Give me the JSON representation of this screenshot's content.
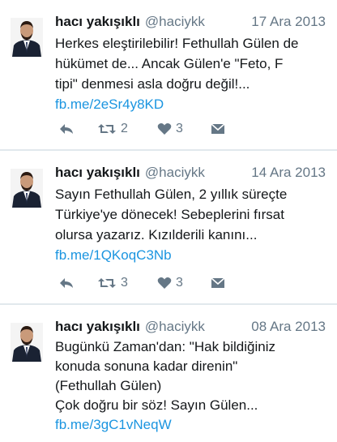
{
  "tweets": [
    {
      "display_name": "hacı yakışıklı",
      "handle": "@haciykk",
      "date": "17 Ara 2013",
      "lines": [
        "Herkes eleştirilebilir! Fethullah Gülen de",
        "hükümet de... Ancak Gülen'e \"Feto, F",
        "tipi\" denmesi asla doğru değil!..."
      ],
      "link": "fb.me/2eSr4y8KD",
      "retweets": "2",
      "likes": "3",
      "show_actions": true
    },
    {
      "display_name": "hacı yakışıklı",
      "handle": "@haciykk",
      "date": "14 Ara 2013",
      "lines": [
        "Sayın Fethullah Gülen, 2 yıllık süreçte",
        "Türkiye'ye dönecek! Sebeplerini fırsat",
        "olursa yazarız. Kızılderili kanını..."
      ],
      "link": "fb.me/1QKoqC3Nb",
      "retweets": "3",
      "likes": "3",
      "show_actions": true
    },
    {
      "display_name": "hacı yakışıklı",
      "handle": "@haciykk",
      "date": "08 Ara 2013",
      "lines": [
        "Bugünkü Zaman'dan: \"Hak bildiğiniz",
        "konuda sonuna kadar direnin\"",
        "(Fethullah Gülen)",
        "Çok doğru bir söz! Sayın Gülen..."
      ],
      "link": "fb.me/3gC1vNeqW",
      "show_actions": false
    }
  ],
  "icons": {
    "reply": "reply-icon",
    "retweet": "retweet-icon",
    "like": "heart-icon",
    "dm": "direct-message-icon"
  },
  "colors": {
    "link": "#1b95e0",
    "muted": "#657786",
    "text": "#14171a",
    "divider": "#e1e8ed"
  }
}
